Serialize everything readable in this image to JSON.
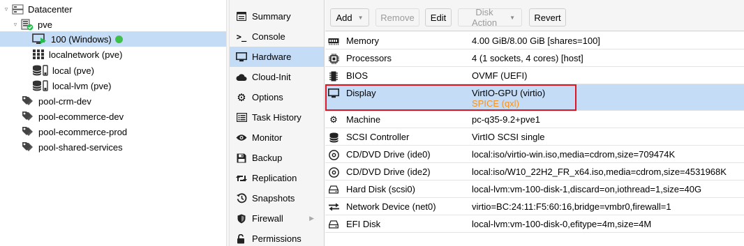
{
  "tree": {
    "datacenter": "Datacenter",
    "node": "pve",
    "vm": "100 (Windows)",
    "storages": [
      "localnetwork (pve)",
      "local (pve)",
      "local-lvm (pve)"
    ],
    "pools": [
      "pool-crm-dev",
      "pool-ecommerce-dev",
      "pool-ecommerce-prod",
      "pool-shared-services"
    ]
  },
  "nav": {
    "items": [
      {
        "label": "Summary",
        "icon": "summary-icon"
      },
      {
        "label": "Console",
        "icon": "console-icon"
      },
      {
        "label": "Hardware",
        "icon": "hardware-icon"
      },
      {
        "label": "Cloud-Init",
        "icon": "cloud-icon"
      },
      {
        "label": "Options",
        "icon": "gear-icon"
      },
      {
        "label": "Task History",
        "icon": "list-icon"
      },
      {
        "label": "Monitor",
        "icon": "eye-icon"
      },
      {
        "label": "Backup",
        "icon": "floppy-icon"
      },
      {
        "label": "Replication",
        "icon": "retweet-icon"
      },
      {
        "label": "Snapshots",
        "icon": "history-icon"
      },
      {
        "label": "Firewall",
        "icon": "shield-icon"
      },
      {
        "label": "Permissions",
        "icon": "unlock-icon"
      }
    ],
    "selected": "Hardware"
  },
  "toolbar": {
    "add": "Add",
    "remove": "Remove",
    "edit": "Edit",
    "disk_action": "Disk Action",
    "revert": "Revert"
  },
  "hardware": [
    {
      "key": "Memory",
      "value": "4.00 GiB/8.00 GiB [shares=100]",
      "icon": "memory-icon"
    },
    {
      "key": "Processors",
      "value": "4 (1 sockets, 4 cores) [host]",
      "icon": "cpu-icon"
    },
    {
      "key": "BIOS",
      "value": "OVMF (UEFI)",
      "icon": "microchip-icon"
    },
    {
      "key": "Display",
      "value": "VirtIO-GPU (virtio)",
      "pending": "SPICE (qxl)",
      "icon": "desktop-icon"
    },
    {
      "key": "Machine",
      "value": "pc-q35-9.2+pve1",
      "icon": "cogs-icon"
    },
    {
      "key": "SCSI Controller",
      "value": "VirtIO SCSI single",
      "icon": "database-icon"
    },
    {
      "key": "CD/DVD Drive (ide0)",
      "value": "local:iso/virtio-win.iso,media=cdrom,size=709474K",
      "icon": "cdrom-icon"
    },
    {
      "key": "CD/DVD Drive (ide2)",
      "value": "local:iso/W10_22H2_FR_x64.iso,media=cdrom,size=4531968K",
      "icon": "cdrom-icon"
    },
    {
      "key": "Hard Disk (scsi0)",
      "value": "local-lvm:vm-100-disk-1,discard=on,iothread=1,size=40G",
      "icon": "hdd-icon"
    },
    {
      "key": "Network Device (net0)",
      "value": "virtio=BC:24:11:F5:60:16,bridge=vmbr0,firewall=1",
      "icon": "exchange-icon"
    },
    {
      "key": "EFI Disk",
      "value": "local-lvm:vm-100-disk-0,efitype=4m,size=4M",
      "icon": "hdd-icon"
    }
  ],
  "colors": {
    "selection": "#c4dcf5",
    "pending": "#f7931e",
    "highlight": "#e0141e",
    "running": "#3fc04a"
  }
}
